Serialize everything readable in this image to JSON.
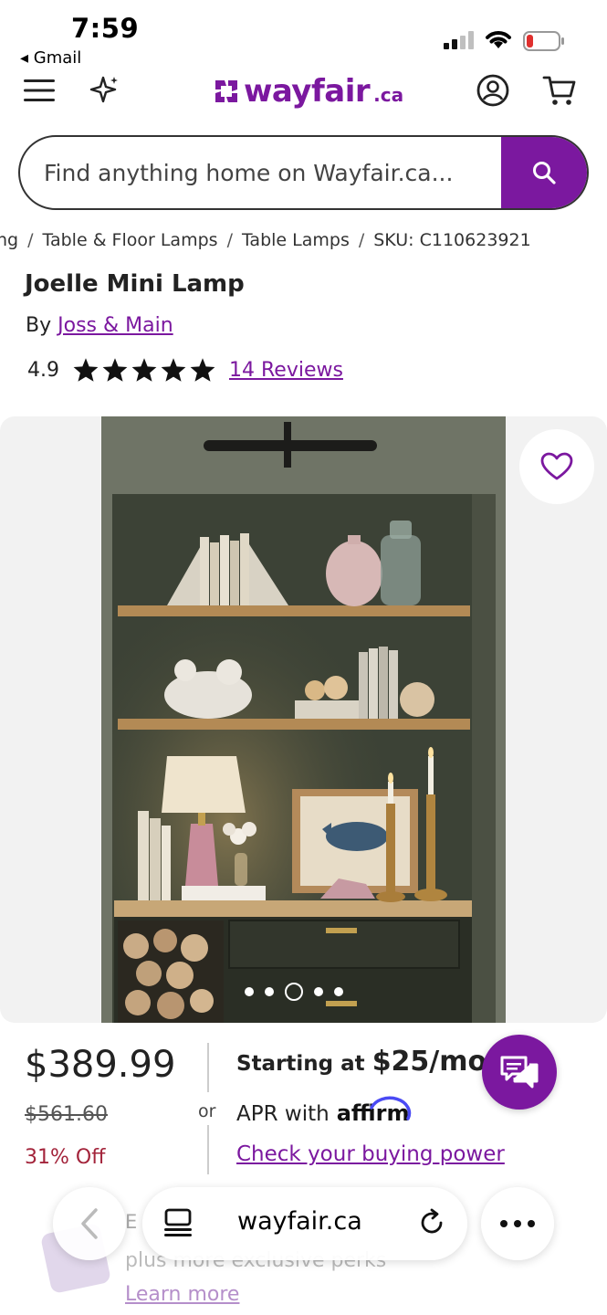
{
  "status_bar": {
    "time": "7:59",
    "back_app": "◂ Gmail"
  },
  "header": {
    "logo_text": "wayfair",
    "logo_suffix": ".ca",
    "brand_color": "#7b189f"
  },
  "search": {
    "placeholder": "Find anything home on Wayfair.ca..."
  },
  "breadcrumb": {
    "items": [
      "ng",
      "Table & Floor Lamps",
      "Table Lamps",
      "SKU: C110623921"
    ]
  },
  "product": {
    "title": "Joelle Mini Lamp",
    "by_label": "By",
    "brand": "Joss & Main",
    "rating": "4.9",
    "rating_value": 4.9,
    "rating_max": 5,
    "reviews_label": "14 Reviews"
  },
  "gallery": {
    "image_count": 5,
    "active_index": 2
  },
  "pricing": {
    "price": "$389.99",
    "was_price": "$561.60",
    "discount": "31% Off",
    "or_label": "or",
    "starting_at": "Starting at",
    "monthly": "$25/mo",
    "apr_with": "APR with",
    "affirm": "affirm",
    "check_power": "Check your buying power"
  },
  "promo": {
    "line1": "E",
    "line2": "plus more exclusive perks",
    "learn_more": "Learn more"
  },
  "browser": {
    "url": "wayfair.ca"
  }
}
